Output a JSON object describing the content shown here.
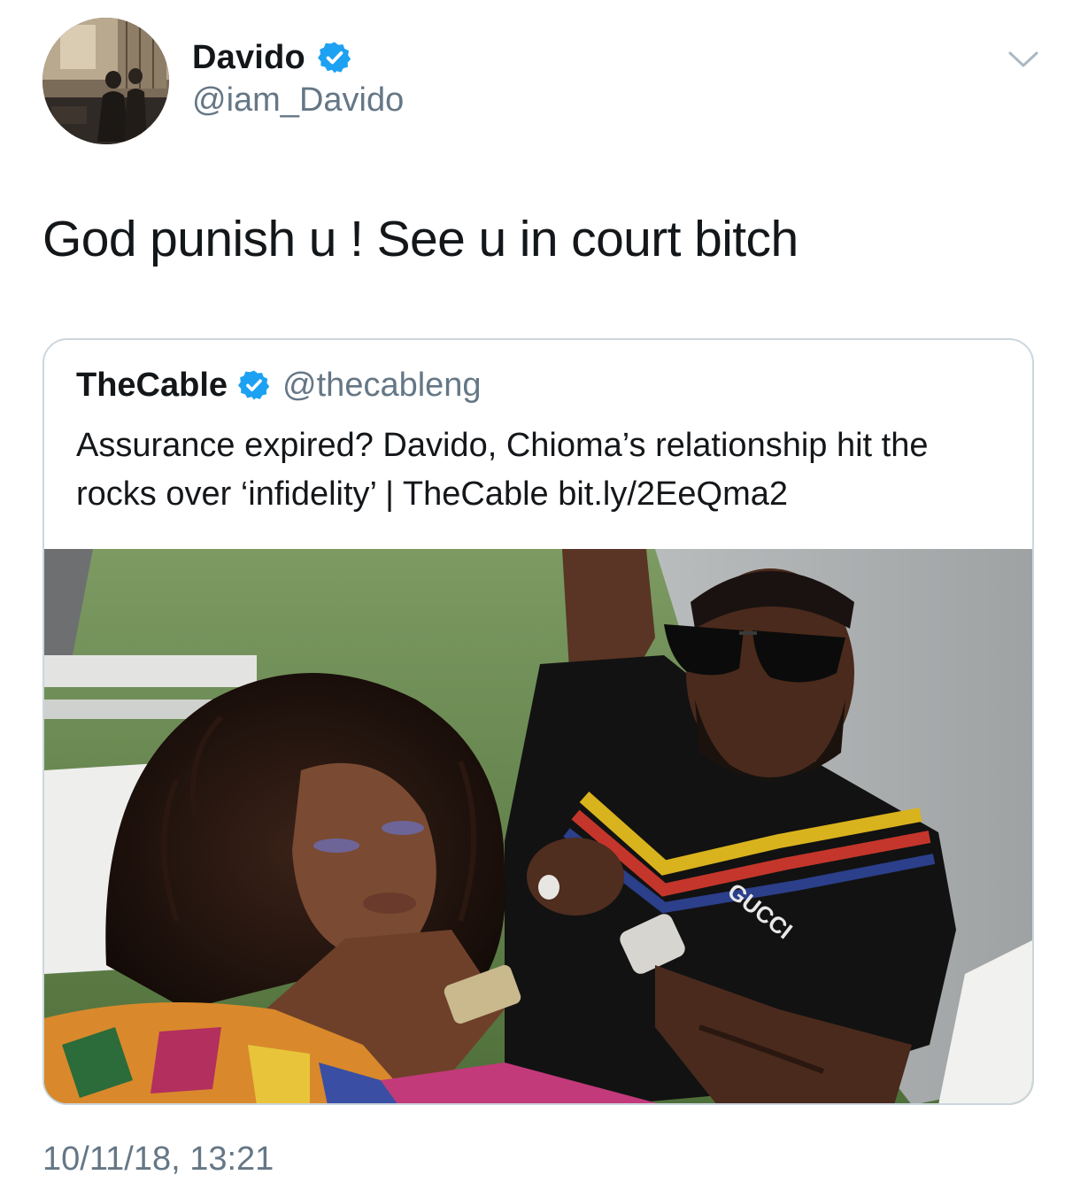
{
  "author": {
    "display_name": "Davido",
    "handle": "@iam_Davido",
    "verified": true,
    "avatar_icon": "profile-photo"
  },
  "tweet": {
    "text": "God punish u ! See u in court bitch",
    "timestamp": "10/11/18, 13:21"
  },
  "quoted_tweet": {
    "display_name": "TheCable",
    "handle": "@thecableng",
    "verified": true,
    "text": "Assurance expired? Davido, Chioma’s relationship hit the rocks over ‘infidelity’ | TheCable bit.ly/2EeQma2",
    "media": {
      "type": "photo",
      "shirt_text": "GUCCI"
    }
  },
  "colors": {
    "text_primary": "#14171a",
    "text_secondary": "#657786",
    "verified_blue": "#1da1f2",
    "border": "#ccd6dd"
  },
  "icons": {
    "verified": "verified-badge-icon",
    "menu": "chevron-down-icon"
  }
}
